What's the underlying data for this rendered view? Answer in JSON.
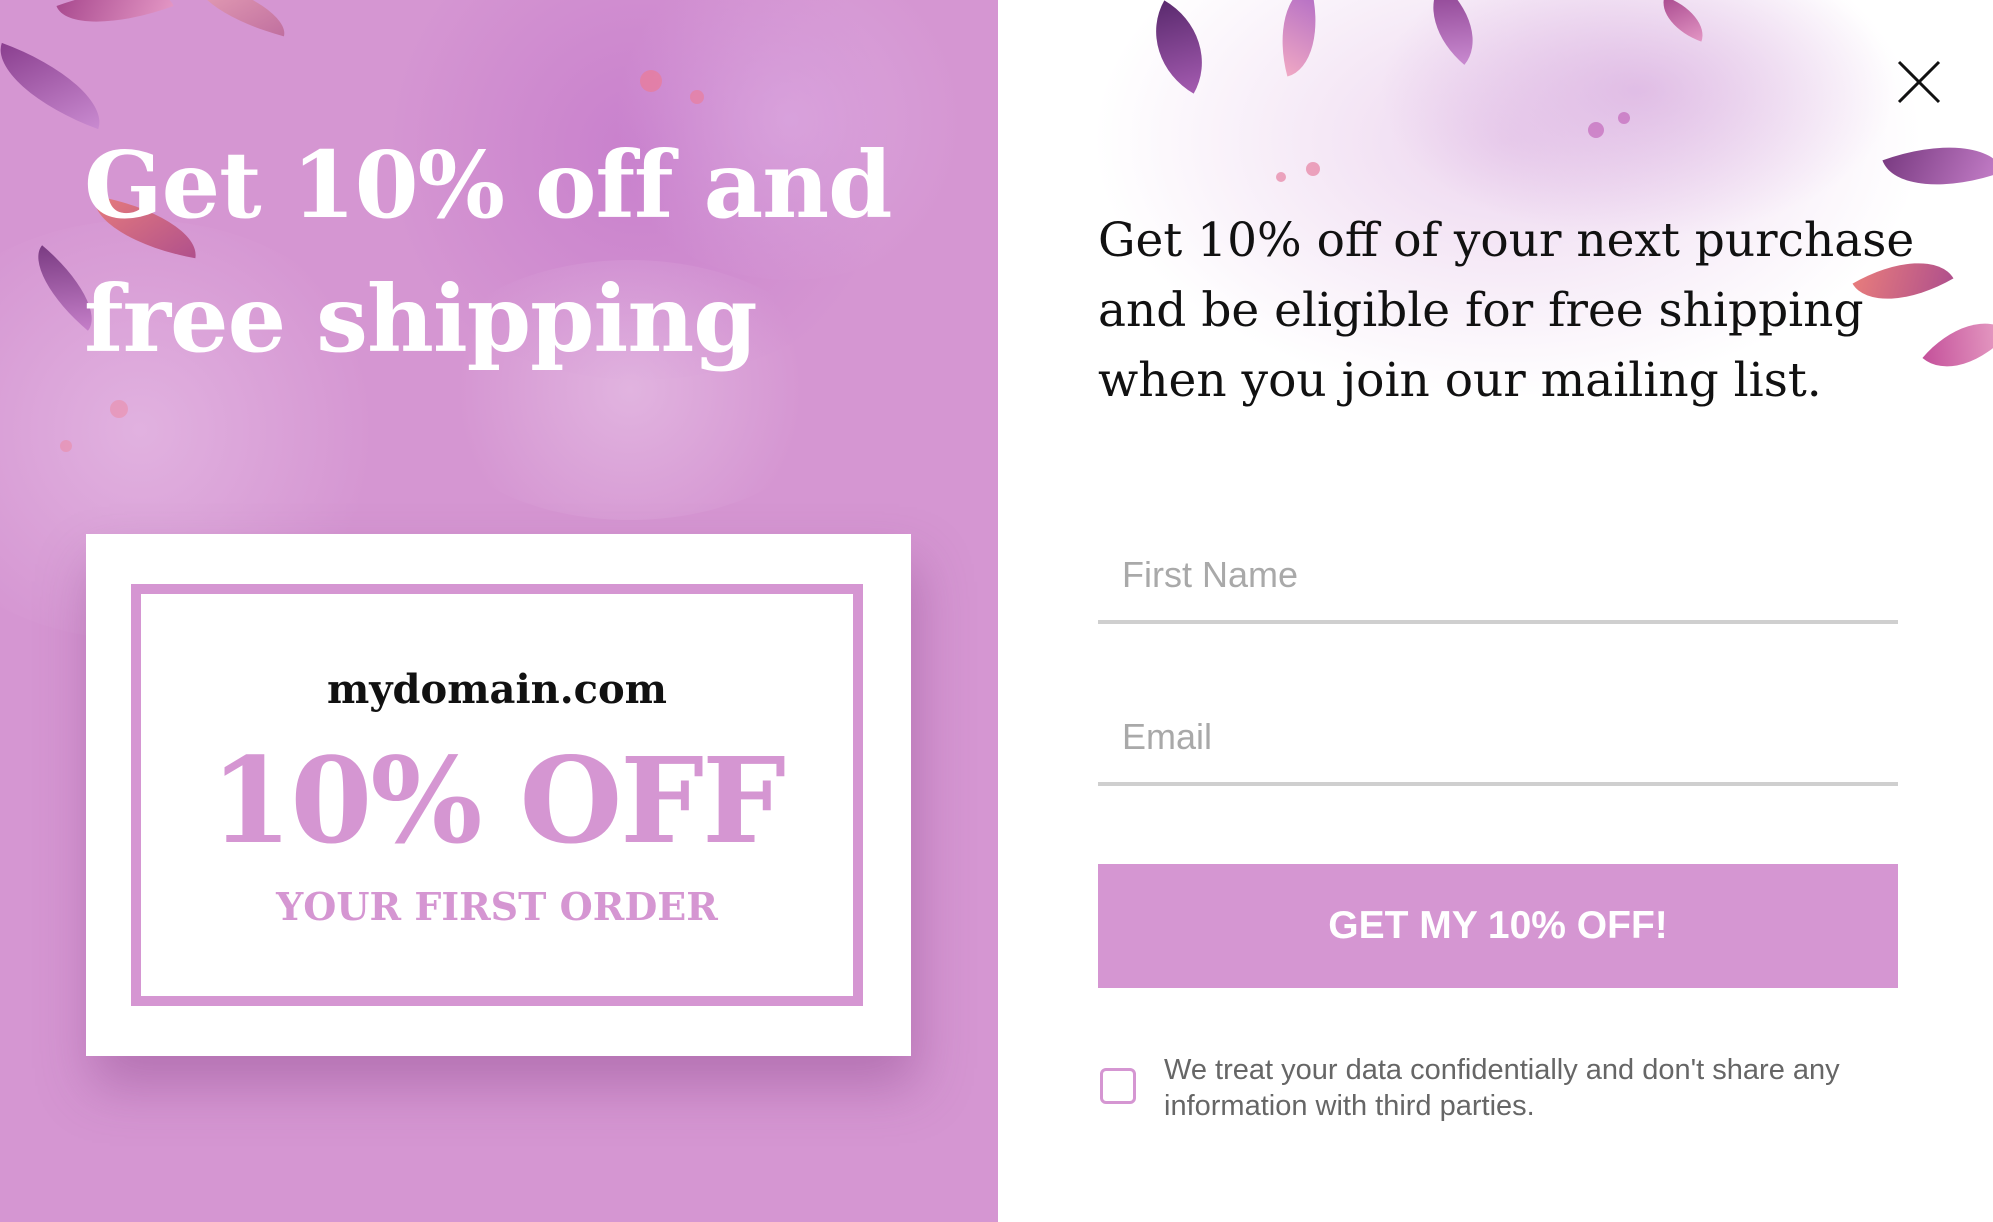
{
  "popup": {
    "headline": "Get 10% off and free shipping",
    "description": "Get 10% off of your next purchase and be eligible for free shipping when you join our mailing list.",
    "close_label": "Close"
  },
  "coupon": {
    "domain": "mydomain.com",
    "amount": "10% OFF",
    "subtitle": "YOUR FIRST ORDER"
  },
  "form": {
    "first_name_placeholder": "First Name",
    "email_placeholder": "Email",
    "submit_label": "GET MY 10% OFF!",
    "consent_text": "We treat your data confidentially and don't share any information with third parties.",
    "consent_checked": false
  },
  "colors": {
    "accent": "#d596d2",
    "text_dark": "#111111",
    "placeholder": "#a9a9a9",
    "underline": "#cfcfcf"
  },
  "icons": {
    "close": "close-icon"
  }
}
